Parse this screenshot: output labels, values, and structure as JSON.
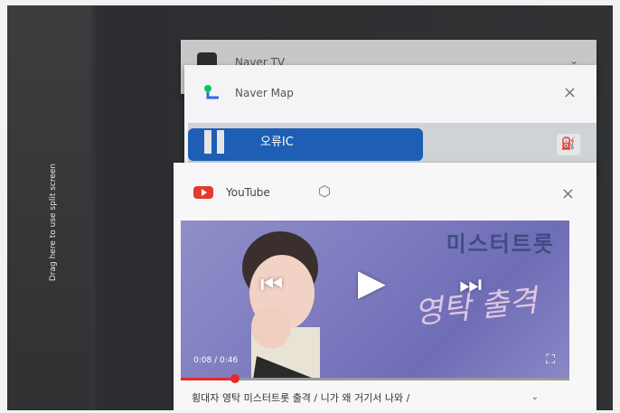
{
  "split_screen": {
    "hint": "Drag here to use split screen"
  },
  "recent_apps": [
    {
      "app": "back-card",
      "title": "Naver TV",
      "close": "×"
    },
    {
      "app": "naver-map",
      "title": "Naver Map",
      "close": "×",
      "preview": {
        "label": "오류IC",
        "fuel_icon": "fuel-pump-icon"
      }
    },
    {
      "app": "youtube",
      "title": "YouTube",
      "close": "×",
      "pin_icon": "pin-icon",
      "video": {
        "art_title": "미스터트롯",
        "art_script": "영탁 출격",
        "time": "0:08 / 0:46",
        "progress": 0.14,
        "caption": "횡대자 영탁 미스터트롯 출격 / 니가 왜 거기서 나와 /"
      }
    }
  ],
  "colors": {
    "youtube_red": "#e23a2f",
    "map_blue": "#1e5fb5",
    "naver_green": "#03c75a"
  }
}
